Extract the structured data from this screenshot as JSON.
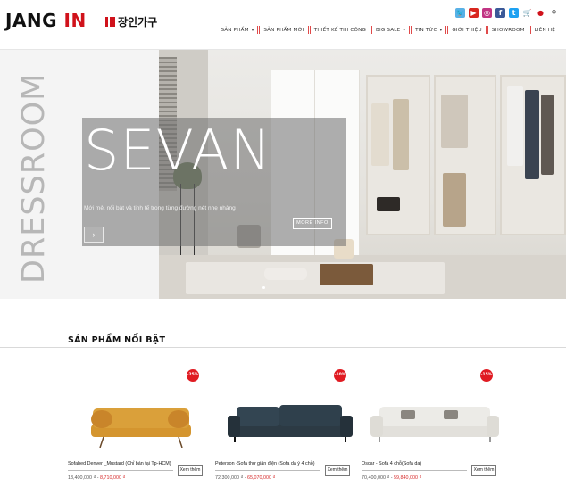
{
  "brand": {
    "name_a": "JANG ",
    "name_b": "IN",
    "name_ko": "장인가구"
  },
  "social_icons": [
    {
      "icon": "twitter-bird-icon",
      "glyph": "🐦",
      "color": "#59b1e6"
    },
    {
      "icon": "youtube-icon",
      "glyph": "▶",
      "color": "#d8271f"
    },
    {
      "icon": "instagram-icon",
      "glyph": "◎",
      "color": "#c13584"
    },
    {
      "icon": "facebook-icon",
      "glyph": "f",
      "color": "#3b5998"
    },
    {
      "icon": "twitter-icon",
      "glyph": "t",
      "color": "#1da1f2"
    },
    {
      "icon": "cart-icon",
      "glyph": "🛒",
      "color": "#444444"
    },
    {
      "icon": "user-icon",
      "glyph": "●",
      "color": "#d0121b"
    },
    {
      "icon": "search-icon",
      "glyph": "⚲",
      "color": "#333333"
    }
  ],
  "nav": {
    "items": [
      {
        "label": "SẢN PHẨM",
        "caret": "▾"
      },
      {
        "label": "SẢN PHẨM MỚI",
        "caret": ""
      },
      {
        "label": "THIẾT KẾ THI CÔNG",
        "caret": ""
      },
      {
        "label": "BIG SALE",
        "caret": "▾"
      },
      {
        "label": "TIN TỨC",
        "caret": "▾"
      },
      {
        "label": "GIỚI THIỆU",
        "caret": ""
      },
      {
        "label": "SHOWROOM",
        "caret": ""
      },
      {
        "label": "LIÊN HỆ",
        "caret": ""
      }
    ]
  },
  "hero": {
    "vertical_text": "DRESSROOM",
    "title": "SEVAN",
    "description": "Mới mẻ, nổi bật và tinh tế trong từng đường nét nhẹ nhàng",
    "more_label": "MORE INFO",
    "arrow_glyph": "›"
  },
  "section": {
    "title": "SẢN PHẨM NỔI BẬT"
  },
  "products": [
    {
      "badge": "-25%",
      "name": "Sofabed Denver _Mustard (Chỉ bán tại Tp-HCM)",
      "old_price": "13,400,000 ₫",
      "separator": " - ",
      "new_price": "8,710,000 ₫",
      "button": "Xem thêm",
      "color": "#d4952f"
    },
    {
      "badge": "-10%",
      "name": "Peterson -Sofa thư giãn điện (Sofa da ý 4 chỗ)",
      "old_price": "72,300,000 ₫",
      "separator": " - ",
      "new_price": "65,070,000 ₫",
      "button": "Xem thêm",
      "color": "#2c3a44"
    },
    {
      "badge": "-15%",
      "name": "Oscar - Sofa 4 chỗ(Sofa da)",
      "old_price": "70,400,000 ₫",
      "separator": " - ",
      "new_price": "59,840,000 ₫",
      "button": "Xem thêm",
      "color": "#ecebe7"
    }
  ]
}
